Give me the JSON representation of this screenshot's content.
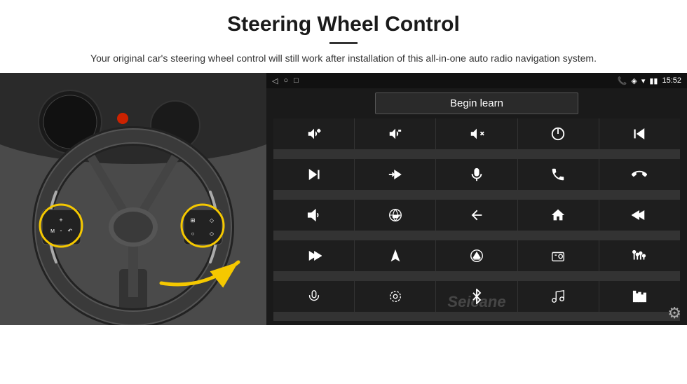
{
  "header": {
    "title": "Steering Wheel Control",
    "subtitle": "Your original car's steering wheel control will still work after installation of this all-in-one auto radio navigation system."
  },
  "device": {
    "status_bar": {
      "time": "15:52",
      "back_icon": "◁",
      "home_icon": "○",
      "recents_icon": "□"
    },
    "begin_learn_label": "Begin learn",
    "watermark": "Seicane",
    "gear_icon": "⚙"
  },
  "grid_icons": [
    {
      "id": "vol-up",
      "label": "Volume Up"
    },
    {
      "id": "vol-down",
      "label": "Volume Down"
    },
    {
      "id": "mute",
      "label": "Mute"
    },
    {
      "id": "power",
      "label": "Power"
    },
    {
      "id": "prev-track",
      "label": "Previous Track"
    },
    {
      "id": "next-track",
      "label": "Next Track"
    },
    {
      "id": "fast-forward",
      "label": "Fast Forward"
    },
    {
      "id": "mic",
      "label": "Microphone"
    },
    {
      "id": "phone",
      "label": "Phone"
    },
    {
      "id": "hang-up",
      "label": "Hang Up"
    },
    {
      "id": "horn",
      "label": "Horn/Speaker"
    },
    {
      "id": "360",
      "label": "360 View"
    },
    {
      "id": "back",
      "label": "Back"
    },
    {
      "id": "home",
      "label": "Home"
    },
    {
      "id": "skip-back",
      "label": "Skip Back"
    },
    {
      "id": "skip-forward",
      "label": "Skip Forward"
    },
    {
      "id": "navigate",
      "label": "Navigate"
    },
    {
      "id": "eject",
      "label": "Eject"
    },
    {
      "id": "radio",
      "label": "Radio"
    },
    {
      "id": "equalizer",
      "label": "Equalizer"
    },
    {
      "id": "mic2",
      "label": "Microphone 2"
    },
    {
      "id": "settings2",
      "label": "Settings"
    },
    {
      "id": "bluetooth",
      "label": "Bluetooth"
    },
    {
      "id": "music",
      "label": "Music"
    },
    {
      "id": "levels",
      "label": "Audio Levels"
    }
  ]
}
